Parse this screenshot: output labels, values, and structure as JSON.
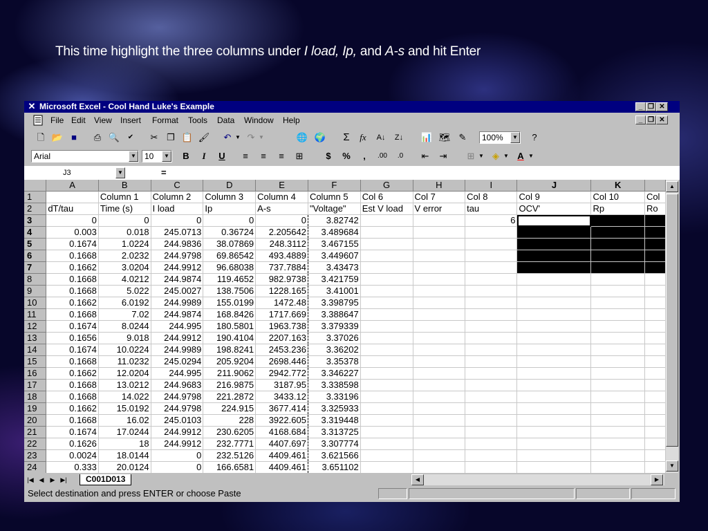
{
  "headline": {
    "part1": "This time highlight the three columns under ",
    "italic1": "I load, Ip,",
    "part2": " and ",
    "italic2": "A-s",
    "part3": " and hit Enter"
  },
  "window": {
    "title": "Microsoft Excel - Cool Hand Luke's Example"
  },
  "menu": [
    "File",
    "Edit",
    "View",
    "Insert",
    "Format",
    "Tools",
    "Data",
    "Window",
    "Help"
  ],
  "toolbar": {
    "zoom": "100%"
  },
  "format": {
    "font": "Arial",
    "size": "10",
    "bold": "B",
    "italic": "I",
    "underline": "U",
    "currency": "$",
    "percent": "%",
    "comma": ","
  },
  "formula_bar": {
    "name_box": "J3",
    "equals": "="
  },
  "columns": [
    "A",
    "B",
    "C",
    "D",
    "E",
    "F",
    "G",
    "H",
    "I",
    "J",
    "K"
  ],
  "rows": [
    [
      "1",
      "",
      "Column 1",
      "Column 2",
      "Column 3",
      "Column 4",
      "Column 5",
      "Col 6",
      "Col 7",
      "Col 8",
      "Col 9",
      "Col 10",
      "Col"
    ],
    [
      "2",
      "dT/tau",
      "Time (s)",
      "I load",
      "Ip",
      "A-s",
      "\"Voltage\"",
      "Est V load",
      "V error",
      "tau",
      "OCV'",
      "Rp",
      "Ro"
    ],
    [
      "3",
      "0",
      "0",
      "0",
      "0",
      "0",
      "3.82742",
      "",
      "",
      "6",
      "",
      "",
      ""
    ],
    [
      "4",
      "0.003",
      "0.018",
      "245.0713",
      "0.36724",
      "2.205642",
      "3.489684",
      "",
      "",
      "",
      "",
      "",
      ""
    ],
    [
      "5",
      "0.1674",
      "1.0224",
      "244.9836",
      "38.07869",
      "248.3112",
      "3.467155",
      "",
      "",
      "",
      "",
      "",
      ""
    ],
    [
      "6",
      "0.1668",
      "2.0232",
      "244.9798",
      "69.86542",
      "493.4889",
      "3.449607",
      "",
      "",
      "",
      "",
      "",
      ""
    ],
    [
      "7",
      "0.1662",
      "3.0204",
      "244.9912",
      "96.68038",
      "737.7884",
      "3.43473",
      "",
      "",
      "",
      "",
      "",
      ""
    ],
    [
      "8",
      "0.1668",
      "4.0212",
      "244.9874",
      "119.4652",
      "982.9738",
      "3.421759",
      "",
      "",
      "",
      "",
      "",
      ""
    ],
    [
      "9",
      "0.1668",
      "5.022",
      "245.0027",
      "138.7506",
      "1228.165",
      "3.41001",
      "",
      "",
      "",
      "",
      "",
      ""
    ],
    [
      "10",
      "0.1662",
      "6.0192",
      "244.9989",
      "155.0199",
      "1472.48",
      "3.398795",
      "",
      "",
      "",
      "",
      "",
      ""
    ],
    [
      "11",
      "0.1668",
      "7.02",
      "244.9874",
      "168.8426",
      "1717.669",
      "3.388647",
      "",
      "",
      "",
      "",
      "",
      ""
    ],
    [
      "12",
      "0.1674",
      "8.0244",
      "244.995",
      "180.5801",
      "1963.738",
      "3.379339",
      "",
      "",
      "",
      "",
      "",
      ""
    ],
    [
      "13",
      "0.1656",
      "9.018",
      "244.9912",
      "190.4104",
      "2207.163",
      "3.37026",
      "",
      "",
      "",
      "",
      "",
      ""
    ],
    [
      "14",
      "0.1674",
      "10.0224",
      "244.9989",
      "198.8241",
      "2453.236",
      "3.36202",
      "",
      "",
      "",
      "",
      "",
      ""
    ],
    [
      "15",
      "0.1668",
      "11.0232",
      "245.0294",
      "205.9204",
      "2698.446",
      "3.35378",
      "",
      "",
      "",
      "",
      "",
      ""
    ],
    [
      "16",
      "0.1662",
      "12.0204",
      "244.995",
      "211.9062",
      "2942.772",
      "3.346227",
      "",
      "",
      "",
      "",
      "",
      ""
    ],
    [
      "17",
      "0.1668",
      "13.0212",
      "244.9683",
      "216.9875",
      "3187.95",
      "3.338598",
      "",
      "",
      "",
      "",
      "",
      ""
    ],
    [
      "18",
      "0.1668",
      "14.022",
      "244.9798",
      "221.2872",
      "3433.12",
      "3.33196",
      "",
      "",
      "",
      "",
      "",
      ""
    ],
    [
      "19",
      "0.1662",
      "15.0192",
      "244.9798",
      "224.915",
      "3677.414",
      "3.325933",
      "",
      "",
      "",
      "",
      "",
      ""
    ],
    [
      "20",
      "0.1668",
      "16.02",
      "245.0103",
      "228",
      "3922.605",
      "3.319448",
      "",
      "",
      "",
      "",
      "",
      ""
    ],
    [
      "21",
      "0.1674",
      "17.0244",
      "244.9912",
      "230.6205",
      "4168.684",
      "3.313725",
      "",
      "",
      "",
      "",
      "",
      ""
    ],
    [
      "22",
      "0.1626",
      "18",
      "244.9912",
      "232.7771",
      "4407.697",
      "3.307774",
      "",
      "",
      "",
      "",
      "",
      ""
    ],
    [
      "23",
      "0.0024",
      "18.0144",
      "0",
      "232.5126",
      "4409.461",
      "3.621566",
      "",
      "",
      "",
      "",
      "",
      ""
    ],
    [
      "24",
      "0.333",
      "20.0124",
      "0",
      "166.6581",
      "4409.461",
      "3.651102",
      "",
      "",
      "",
      "",
      "",
      ""
    ]
  ],
  "sheet_tab": "C001D013",
  "status_text": "Select destination and press ENTER or choose Paste"
}
